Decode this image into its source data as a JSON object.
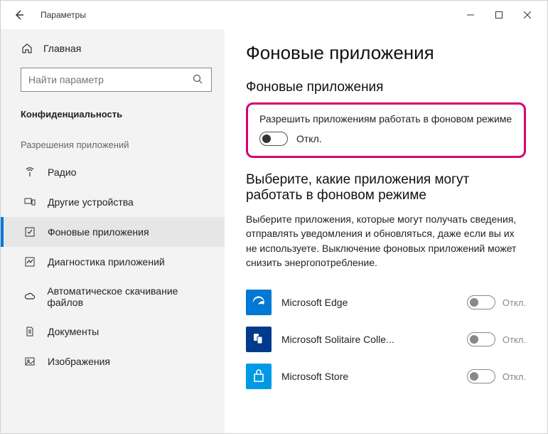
{
  "window": {
    "title": "Параметры"
  },
  "sidebar": {
    "home": "Главная",
    "search_placeholder": "Найти параметр",
    "section": "Конфиденциальность",
    "permissions_header": "Разрешения приложений",
    "items": [
      {
        "label": "Радио"
      },
      {
        "label": "Другие устройства"
      },
      {
        "label": "Фоновые приложения"
      },
      {
        "label": "Диагностика приложений"
      },
      {
        "label": "Автоматическое скачивание файлов"
      },
      {
        "label": "Документы"
      },
      {
        "label": "Изображения"
      }
    ]
  },
  "main": {
    "h1": "Фоновые приложения",
    "h2a": "Фоновые приложения",
    "master_label": "Разрешить приложениям работать в фоновом режиме",
    "master_state": "Откл.",
    "h2b": "Выберите, какие приложения могут работать в фоновом режиме",
    "desc": "Выберите приложения, которые могут получать сведения, отправлять уведомления и обновляться, даже если вы их не используете. Выключение фоновых приложений может снизить энергопотребление.",
    "apps": [
      {
        "name": "Microsoft Edge",
        "state": "Откл."
      },
      {
        "name": "Microsoft Solitaire Colle...",
        "state": "Откл."
      },
      {
        "name": "Microsoft Store",
        "state": "Откл."
      }
    ]
  }
}
